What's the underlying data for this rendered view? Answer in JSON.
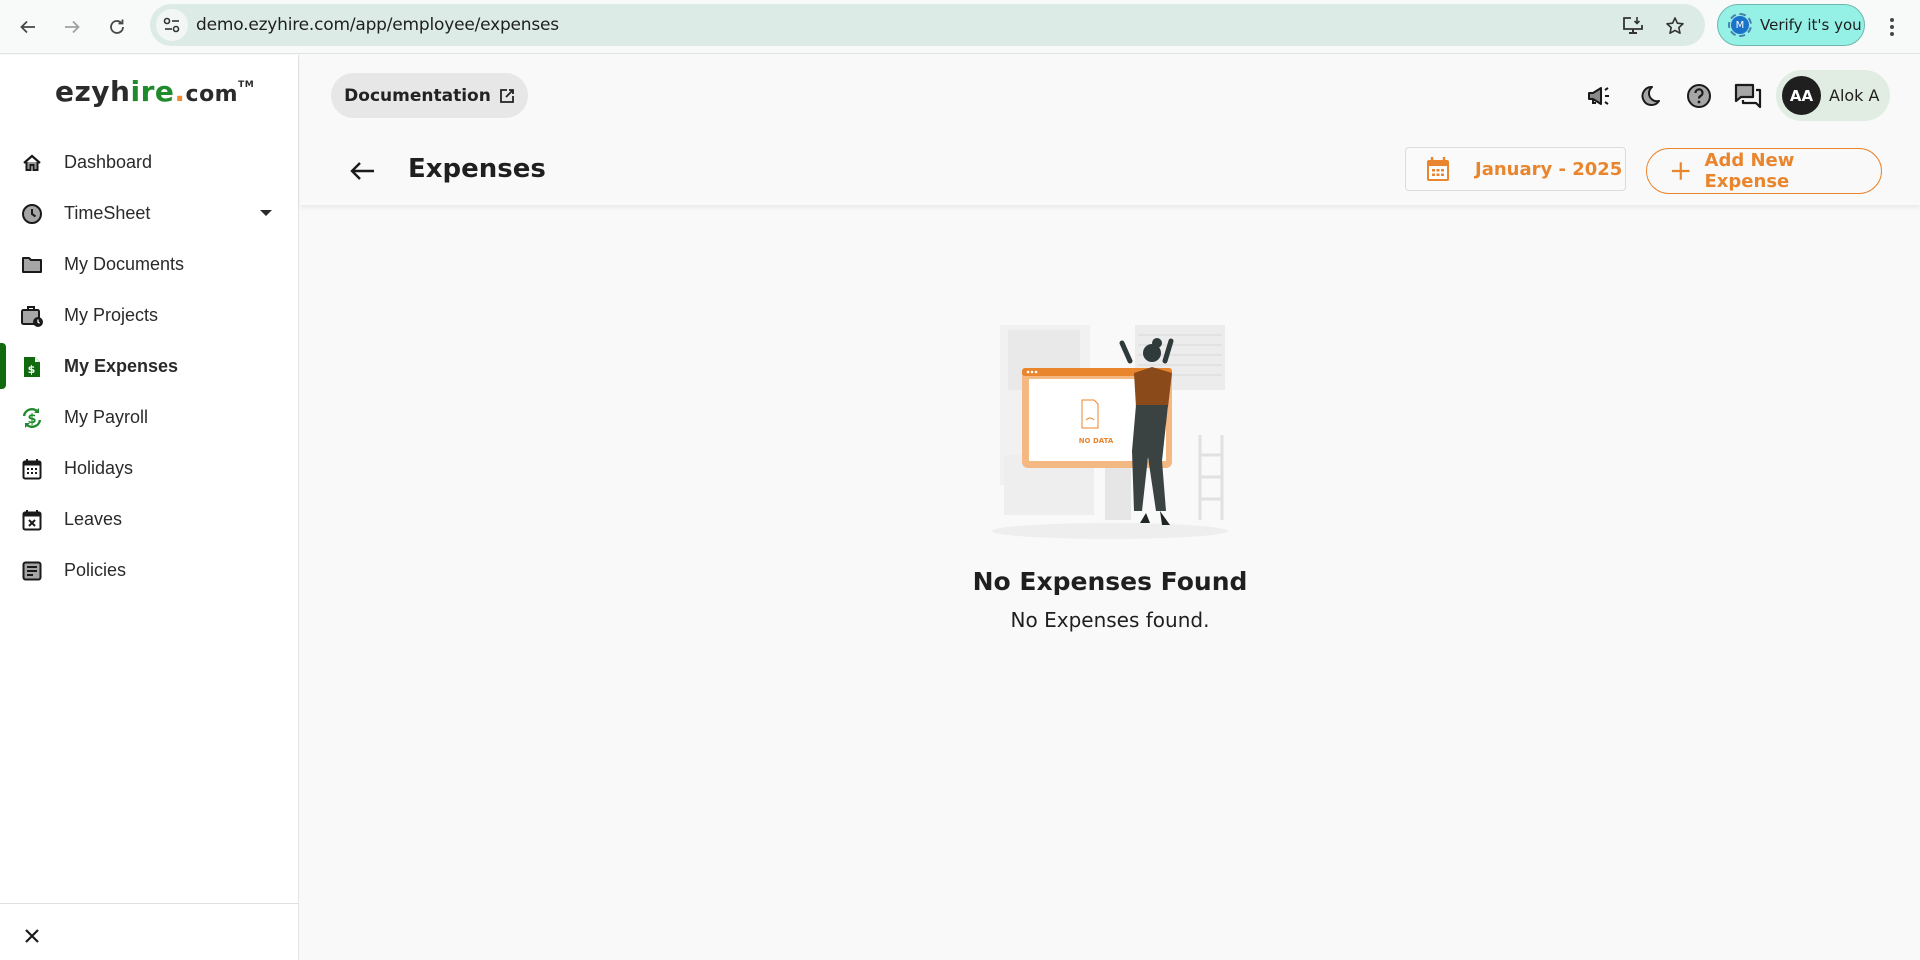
{
  "browser": {
    "url": "demo.ezyhire.com/app/employee/expenses",
    "verify_label": "Verify it's you",
    "verify_avatar_initial": "M"
  },
  "logo": {
    "part1": "ezyh",
    "part2": "ire",
    "dot": ".",
    "part3": "com",
    "tm": "TM"
  },
  "sidebar": {
    "items": [
      {
        "label": "Dashboard",
        "icon": "home-icon"
      },
      {
        "label": "TimeSheet",
        "icon": "clock-icon",
        "has_dropdown": true
      },
      {
        "label": "My Documents",
        "icon": "folder-icon"
      },
      {
        "label": "My Projects",
        "icon": "briefcase-clock-icon"
      },
      {
        "label": "My Expenses",
        "icon": "dollar-file-icon",
        "active": true
      },
      {
        "label": "My Payroll",
        "icon": "dollar-sync-icon"
      },
      {
        "label": "Holidays",
        "icon": "calendar-icon"
      },
      {
        "label": "Leaves",
        "icon": "calendar-x-icon"
      },
      {
        "label": "Policies",
        "icon": "document-lines-icon"
      }
    ],
    "close_icon": "close-icon"
  },
  "header": {
    "documentation_label": "Documentation",
    "user_initials": "AA",
    "user_name": "Alok A",
    "page_title": "Expenses",
    "month_label": "January - 2025",
    "add_label": "Add New Expense"
  },
  "empty_state": {
    "illustration_text": "NO DATA",
    "title": "No Expenses Found",
    "subtitle": "No Expenses found."
  },
  "colors": {
    "accent": "#e9852d",
    "active_green": "#116b0e",
    "url_bar": "#dcebe6",
    "verify_bg": "#95f1e6",
    "user_chip_bg": "#e1ede2"
  }
}
